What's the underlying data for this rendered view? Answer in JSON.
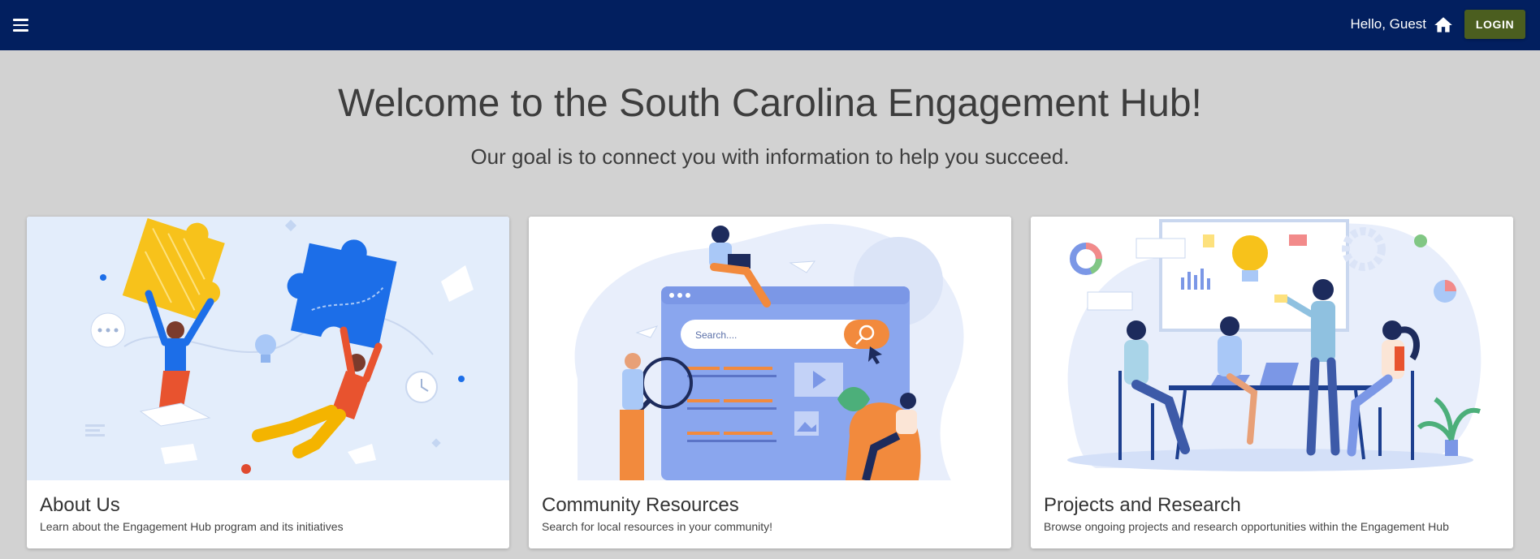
{
  "header": {
    "greeting": "Hello, Guest",
    "login_label": "LOGIN",
    "menu_icon": "menu-icon",
    "home_icon": "home-icon",
    "colors": {
      "bar": "#021f5f",
      "login": "#4b5e1f"
    }
  },
  "hero": {
    "title": "Welcome to the South Carolina Engagement Hub!",
    "subtitle": "Our goal is to connect you with information to help you succeed."
  },
  "cards": [
    {
      "title": "About Us",
      "description": "Learn about the Engagement Hub program and its initiatives",
      "illustration": "puzzle-people-illustration"
    },
    {
      "title": "Community Resources",
      "description": "Search for local resources in your community!",
      "illustration": "search-browser-illustration",
      "search_placeholder": "Search...."
    },
    {
      "title": "Projects and Research",
      "description": "Browse ongoing projects and research opportunities within the Engagement Hub",
      "illustration": "team-meeting-illustration"
    }
  ]
}
